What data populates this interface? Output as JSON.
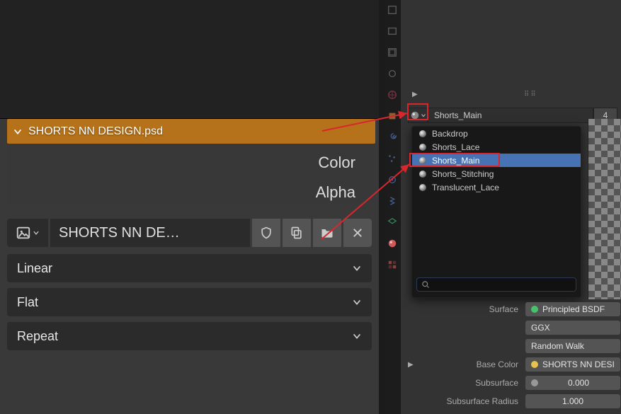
{
  "top_clipped_material": "Translucent_Lace",
  "panel_header": "SHORTS NN DESIGN.psd",
  "labels": {
    "color": "Color",
    "alpha": "Alpha"
  },
  "image_field": "SHORTS NN DE…",
  "dropdowns": {
    "interp": "Linear",
    "projection": "Flat",
    "extension": "Repeat"
  },
  "mat_linked": {
    "name": "Shorts_Main",
    "users": "4"
  },
  "mat_list": [
    "Backdrop",
    "Shorts_Lace",
    "Shorts_Main",
    "Shorts_Stitching",
    "Translucent_Lace"
  ],
  "selected_mat": "Shorts_Main",
  "search_value": "",
  "search_placeholder": "",
  "surface": {
    "label_surface": "Surface",
    "label_basecolor": "Base Color",
    "label_subsurface": "Subsurface",
    "label_subsurfaceradius": "Subsurface Radius",
    "shader": "Principled BSDF",
    "distribution": "GGX",
    "sss_method": "Random Walk",
    "basecolor": "SHORTS NN DESIGN.psd",
    "subsurface": "0.000",
    "subsurface_radius": "1.000"
  }
}
